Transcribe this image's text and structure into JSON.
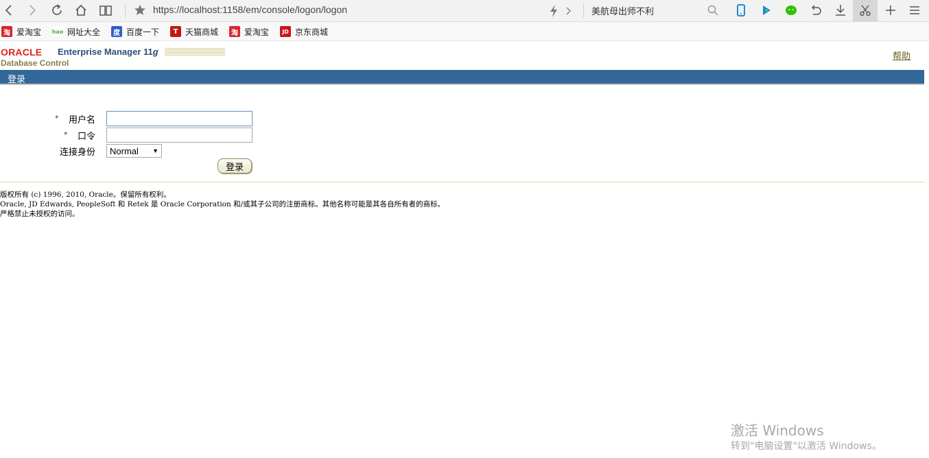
{
  "browser": {
    "address_url": "https://localhost:1158/em/console/logon/logon",
    "search_text": "美航母出师不利",
    "icons": [
      "back-icon",
      "forward-icon",
      "refresh-icon",
      "home-icon",
      "reader-icon",
      "star-icon",
      "lightning-icon",
      "chevron-right-icon",
      "search-icon",
      "phone-icon",
      "play-icon",
      "wechat-icon",
      "undo-icon",
      "download-icon",
      "scissors-icon",
      "plus-icon",
      "menu-icon"
    ]
  },
  "bookmarks": [
    {
      "label": "爱淘宝",
      "icon": "淘",
      "color": "#d6262d"
    },
    {
      "label": "网址大全",
      "icon": "hao",
      "color": "#4caf50"
    },
    {
      "label": "百度一下",
      "icon": "度",
      "color": "#2d5fc8"
    },
    {
      "label": "天猫商城",
      "icon": "T",
      "color": "#c4161c"
    },
    {
      "label": "爱淘宝",
      "icon": "淘",
      "color": "#d6262d"
    },
    {
      "label": "京东商城",
      "icon": "JD",
      "color": "#c8161d"
    }
  ],
  "header": {
    "oracle_logo": "ORACLE",
    "product": "Enterprise Manager 11",
    "version_suffix": "g",
    "subtitle": "Database Control",
    "help": "帮助",
    "page_title": "登录"
  },
  "form": {
    "required_mark": "*",
    "username_label": "用户名",
    "username_value": "",
    "password_label": "口令",
    "password_value": "",
    "connect_as_label": "连接身份",
    "connect_as_value": "Normal",
    "login_button": "登录"
  },
  "footer": {
    "line1": "版权所有 (c) 1996, 2010, Oracle。保留所有权利。",
    "line2": "Oracle, JD Edwards, PeopleSoft 和 Retek 是 Oracle Corporation 和/或其子公司的注册商标。其他名称可能是其各自所有者的商标。",
    "line3": "严格禁止未授权的访问。"
  },
  "watermark": {
    "line1": "激活 Windows",
    "line2": "转到\"电脑设置\"以激活 Windows。"
  }
}
